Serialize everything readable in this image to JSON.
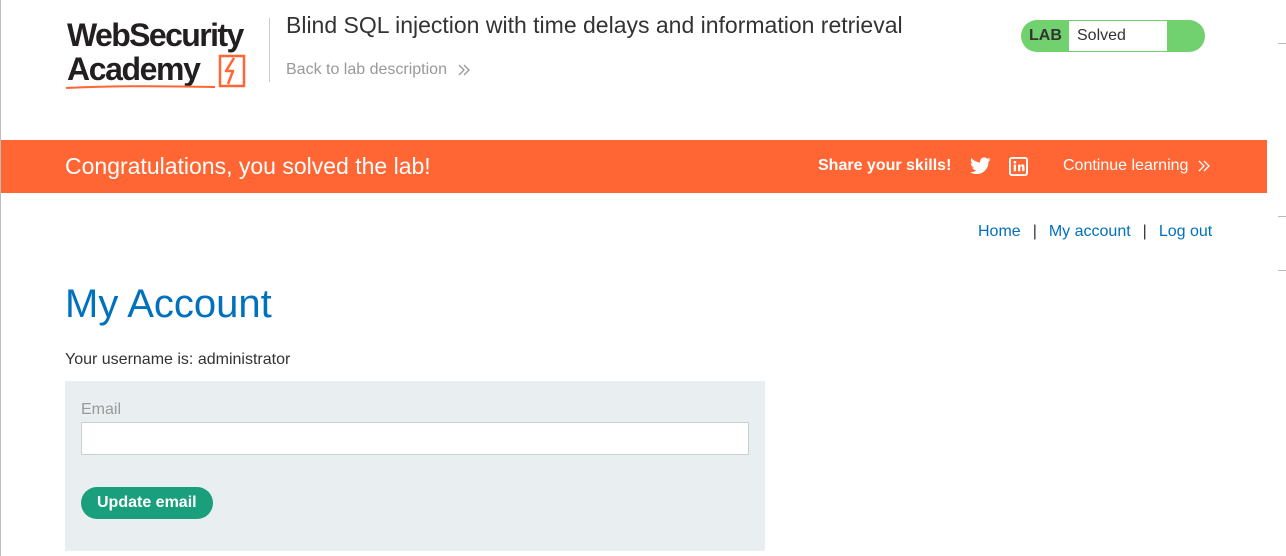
{
  "header": {
    "logo": {
      "line1": "WebSecurity",
      "line2": "Academy"
    },
    "lab_title": "Blind SQL injection with time delays and information retrieval",
    "back_link": "Back to lab description",
    "lab_status": {
      "label": "LAB",
      "status": "Solved",
      "color": "#70d16e"
    }
  },
  "banner": {
    "message": "Congratulations, you solved the lab!",
    "share_label": "Share your skills!",
    "icons": [
      "twitter-icon",
      "linkedin-icon"
    ],
    "continue_label": "Continue learning",
    "color": "#ff6633"
  },
  "nav": {
    "links": [
      "Home",
      "My account",
      "Log out"
    ],
    "separator": "|"
  },
  "main": {
    "title": "My Account",
    "username_line": "Your username is: administrator",
    "form": {
      "email_label": "Email",
      "email_value": "",
      "submit_label": "Update email"
    }
  },
  "colors": {
    "link": "#0071bc",
    "button": "#1a9f7d",
    "panel": "#e9eef0"
  }
}
